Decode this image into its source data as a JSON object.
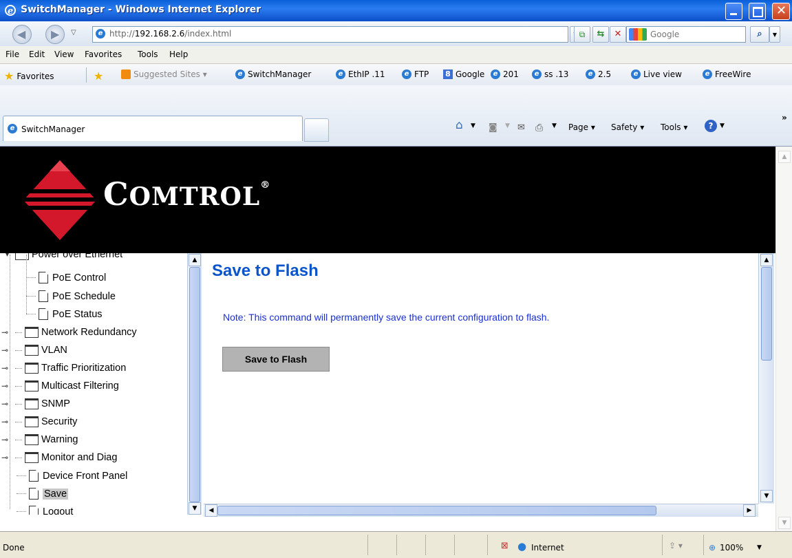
{
  "window": {
    "title": "SwitchManager - Windows Internet Explorer"
  },
  "address": {
    "url_prefix": "http://",
    "url_host": "192.168.2.6",
    "url_path": "/index.html"
  },
  "search": {
    "placeholder": "Google"
  },
  "menu": [
    "File",
    "Edit",
    "View",
    "Favorites",
    "Tools",
    "Help"
  ],
  "favorites_bar": {
    "favorites_label": "Favorites",
    "suggested": "Suggested Sites ▾",
    "links": [
      "SwitchManager",
      "EthIP .11",
      "FTP",
      "Google",
      "201",
      "ss .13",
      "2.5",
      "Live view",
      "FreeWire"
    ]
  },
  "tabs": {
    "active": "SwitchManager"
  },
  "command_bar": {
    "page": "Page ▾",
    "safety": "Safety ▾",
    "tools": "Tools ▾"
  },
  "banner": {
    "logo_first": "C",
    "logo_rest": "OMTROL",
    "logo_mark": "®"
  },
  "tree": {
    "partial_top": "Power over Ethernet",
    "items": [
      {
        "label": "PoE Control",
        "kind": "page",
        "depth": 2
      },
      {
        "label": "PoE Schedule",
        "kind": "page",
        "depth": 2
      },
      {
        "label": "PoE Status",
        "kind": "page",
        "depth": 2
      },
      {
        "label": "Network Redundancy",
        "kind": "folder",
        "depth": 0
      },
      {
        "label": "VLAN",
        "kind": "folder",
        "depth": 0
      },
      {
        "label": "Traffic Prioritization",
        "kind": "folder",
        "depth": 0
      },
      {
        "label": "Multicast Filtering",
        "kind": "folder",
        "depth": 0
      },
      {
        "label": "SNMP",
        "kind": "folder",
        "depth": 0
      },
      {
        "label": "Security",
        "kind": "folder",
        "depth": 0
      },
      {
        "label": "Warning",
        "kind": "folder",
        "depth": 0
      },
      {
        "label": "Monitor and Diag",
        "kind": "folder",
        "depth": 0
      },
      {
        "label": "Device Front Panel",
        "kind": "page",
        "depth": 1
      },
      {
        "label": "Save",
        "kind": "page",
        "depth": 1,
        "selected": true
      },
      {
        "label": "Logout",
        "kind": "page",
        "depth": 1
      }
    ]
  },
  "main": {
    "title": "Save to Flash",
    "note": "Note: This command will permanently save the current configuration to flash.",
    "button": "Save to Flash"
  },
  "status": {
    "left": "Done",
    "zone": "Internet",
    "zoom": "100%"
  },
  "colors": {
    "title_bar": "#0a5fd8",
    "heading": "#0a55c9",
    "note": "#1a2fd4",
    "banner": "#000000",
    "logo_red": "#d3182b"
  }
}
